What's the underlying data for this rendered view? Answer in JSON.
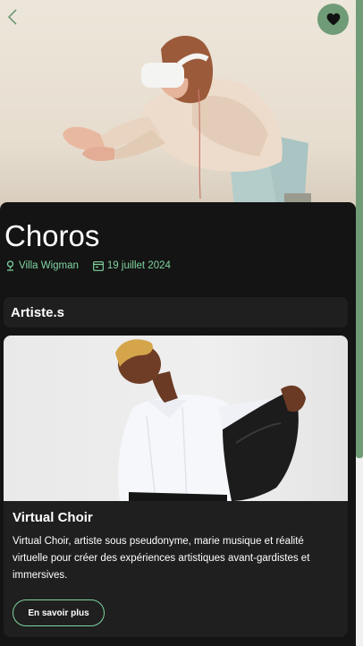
{
  "event": {
    "title": "Choros",
    "venue": "Villa Wigman",
    "date": "19 juillet 2024",
    "venue_icon": "location-pin-icon",
    "date_icon": "calendar-icon"
  },
  "nav": {
    "back_icon": "chevron-left-icon",
    "favorite_icon": "heart-icon"
  },
  "section": {
    "title": "Artiste.s"
  },
  "artists": [
    {
      "name": "Virtual Choir",
      "description": "Virtual Choir, artiste sous pseudonyme, marie musique et réalité virtuelle pour créer des expériences artistiques avant-gardistes et immersives.",
      "button_label": "En savoir plus"
    }
  ],
  "colors": {
    "accent": "#6f9b76",
    "accent_text": "#7fd3a0",
    "background": "#141414",
    "card": "#1f1f1f"
  }
}
